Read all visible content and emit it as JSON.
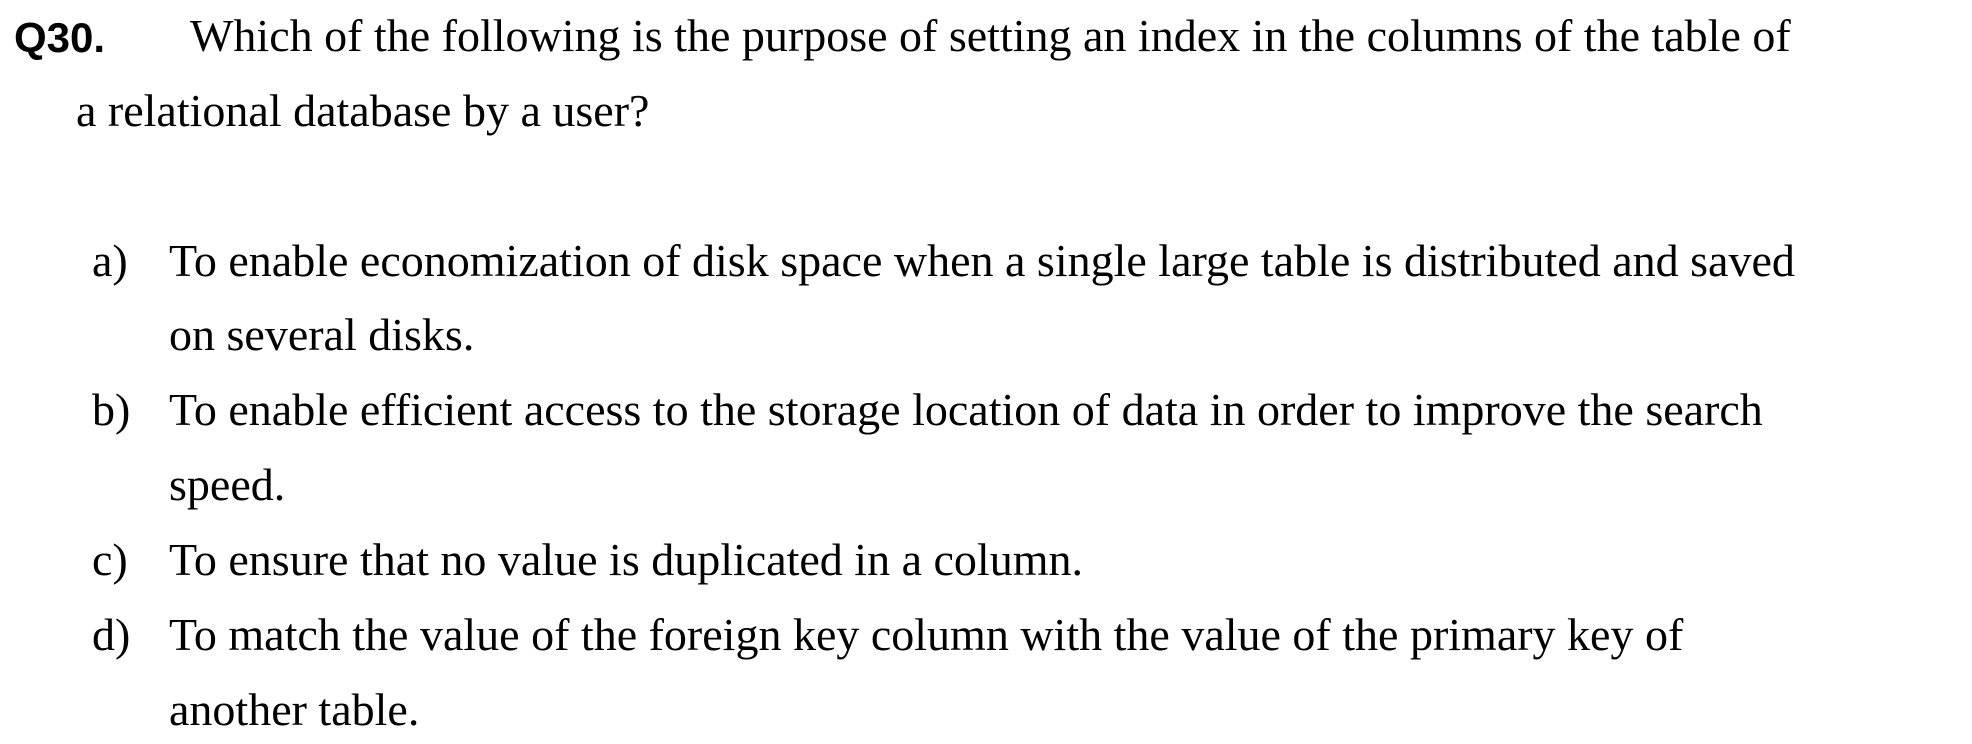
{
  "question": {
    "number": "Q30.",
    "lines": [
      "Which of the following is the purpose of setting an index in the columns of the table of",
      "a relational database by a user?"
    ]
  },
  "options": [
    {
      "letter": "a)",
      "lines": [
        "To enable economization of disk space when a single large table is distributed and saved",
        "on several disks."
      ]
    },
    {
      "letter": "b)",
      "lines": [
        "To enable efficient access to the storage location of data in order to improve the search",
        "speed."
      ]
    },
    {
      "letter": "c)",
      "lines": [
        "To ensure that no value is duplicated in a column."
      ]
    },
    {
      "letter": "d)",
      "lines": [
        "To match the value of the foreign key column with the value of the primary key of",
        "another table."
      ]
    }
  ]
}
